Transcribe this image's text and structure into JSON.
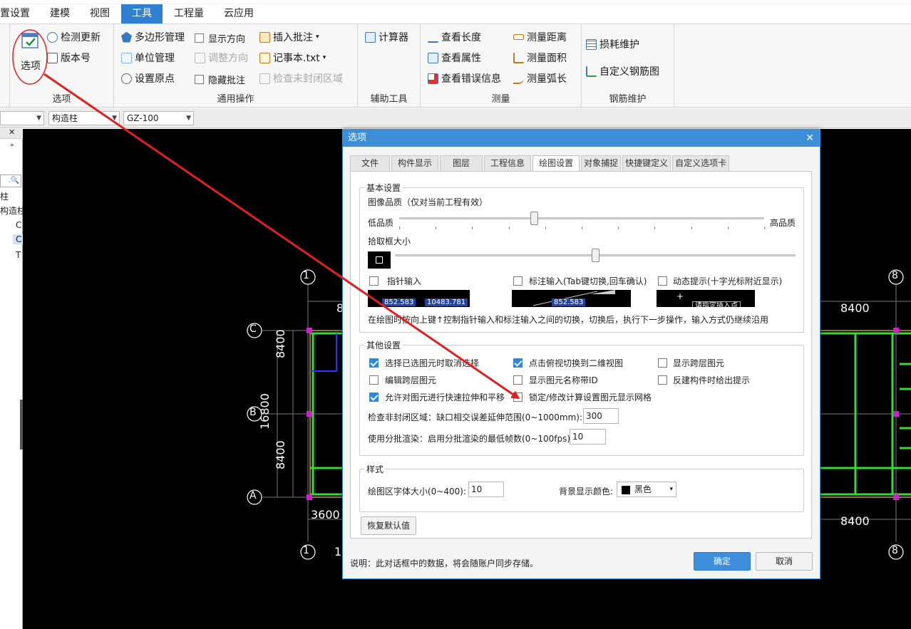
{
  "menubar": {
    "items": [
      "置设置",
      "建模",
      "视图",
      "工具",
      "工程量",
      "云应用"
    ],
    "active_index": 3
  },
  "ribbon": {
    "options_group": {
      "big_button": "选项",
      "check_update": "检测更新",
      "version": "版本号",
      "label": "选项"
    },
    "general_group": {
      "polygon_mgmt": "多边形管理",
      "unit_mgmt": "单位管理",
      "set_origin": "设置原点",
      "show_direction": "显示方向",
      "adjust_direction": "调整方向",
      "hide_annotation": "隐藏批注",
      "insert_annotation": "插入批注",
      "notepad": "记事本.txt",
      "check_unclosed": "检查未封闭区域",
      "label": "通用操作"
    },
    "aux_group": {
      "calculator": "计算器",
      "label": "辅助工具"
    },
    "measure_group": {
      "view_length": "查看长度",
      "view_props": "查看属性",
      "view_errors": "查看错误信息",
      "measure_distance": "测量距离",
      "measure_area": "测量面积",
      "measure_arc": "测量弧长",
      "label": "测量"
    },
    "rebar_group": {
      "loss_maint": "损耗维护",
      "custom_rebar": "自定义钢筋图",
      "label": "钢筋维护"
    }
  },
  "selector_bar": {
    "sel1": "",
    "sel2": "构造柱",
    "sel3": "GZ-100"
  },
  "left_panel": {
    "items": [
      "柱",
      "构造柱",
      "C",
      "C",
      "T"
    ]
  },
  "canvas": {
    "axis_labels": {
      "top_left": "1",
      "top_right": "8",
      "bottom_left": "1",
      "bottom_right": "8",
      "row_c": "C",
      "row_b": "B",
      "row_a": "A"
    },
    "dims": {
      "top_right": "8400",
      "bottom_right": "8400",
      "left_upper": "8400",
      "left_total": "16800",
      "left_lower": "8400",
      "bottom_left": "3600",
      "top_left_partial": "8",
      "bottom_left_partial": "1"
    }
  },
  "dialog": {
    "title": "选项",
    "tabs": [
      "文件",
      "构件显示",
      "图层",
      "工程信息",
      "绘图设置",
      "对象捕捉",
      "快捷键定义",
      "自定义选项卡"
    ],
    "active_tab": 4,
    "basic": {
      "legend": "基本设置",
      "quality_label": "图像品质（仅对当前工程有效）",
      "low": "低品质",
      "high": "高品质",
      "quality_level": 0.37,
      "pickbox_label": "拾取框大小",
      "pickbox_level": 0.5,
      "pointer_input": "指针输入",
      "dim_input": "标注输入(Tab键切换,回车确认)",
      "dynamic_hint": "动态提示(十字光标附近显示)",
      "preview1_a": "852.583",
      "preview1_b": "10483.781",
      "preview2_a": "852.583",
      "preview3_text": "请指定插入点",
      "hint": "在绘图时按向上键↑控制指针输入和标注输入之间的切换，切换后，执行下一步操作，输入方式仍继续沿用"
    },
    "other": {
      "legend": "其他设置",
      "opt1": "选择已选图元时取消选择",
      "opt1_checked": true,
      "opt2": "点击俯视切换到二维视图",
      "opt2_checked": true,
      "opt3": "显示跨层图元",
      "opt3_checked": false,
      "opt4": "编辑跨层图元",
      "opt4_checked": false,
      "opt5": "显示图元名称带ID",
      "opt5_checked": false,
      "opt6": "反建构件时给出提示",
      "opt6_checked": false,
      "opt7": "允许对图元进行快速拉伸和平移",
      "opt7_checked": true,
      "opt8": "锁定/修改计算设置图元显示网格",
      "opt8_checked": false,
      "unclosed_label": "检查非封闭区域：缺口相交误差延伸范围(0~1000mm):",
      "unclosed_value": "300",
      "batch_label": "使用分批渲染：启用分批渲染的最低帧数(0~100fps):",
      "batch_value": "10"
    },
    "style": {
      "legend": "样式",
      "font_label": "绘图区字体大小(0~400):",
      "font_value": "10",
      "bg_label": "背景显示颜色:",
      "bg_value": "黑色",
      "bg_color": "#000000"
    },
    "restore": "恢复默认值",
    "note": "说明：此对话框中的数据，将会随账户同步存储。",
    "ok": "确定",
    "cancel": "取消"
  },
  "colors": {
    "accent": "#3c8ed8",
    "annotation": "#e02020",
    "grid_line": "#33dd33"
  }
}
